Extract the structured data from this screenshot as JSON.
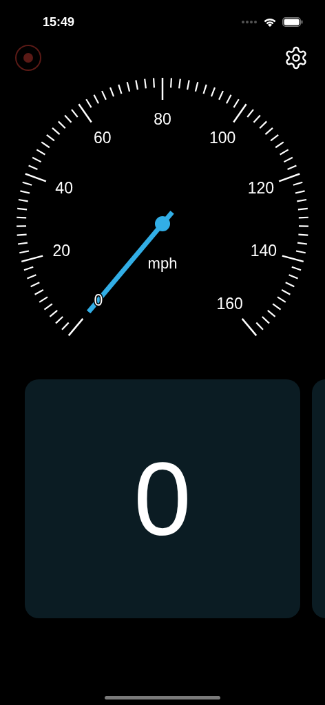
{
  "status_bar": {
    "time": "15:49"
  },
  "toolbar": {
    "recording": false
  },
  "gauge": {
    "unit": "mph",
    "scale_labels": [
      "0",
      "20",
      "40",
      "60",
      "80",
      "100",
      "120",
      "140",
      "160"
    ]
  },
  "cards": [
    {
      "value": "0"
    }
  ]
}
